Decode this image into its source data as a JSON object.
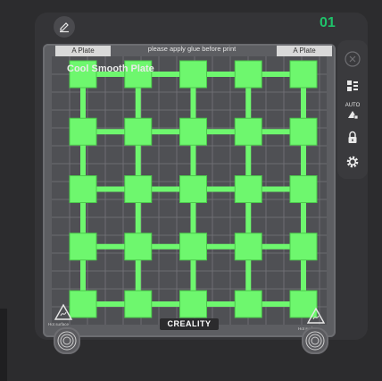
{
  "header": {
    "edit_icon": "pencil-icon",
    "plate_index": "01"
  },
  "toolbar": {
    "items": [
      {
        "name": "close-icon"
      },
      {
        "name": "arrange-icon"
      },
      {
        "name": "auto-orient-icon",
        "label": "AUTO"
      },
      {
        "name": "lock-icon"
      },
      {
        "name": "settings-icon"
      }
    ]
  },
  "plate": {
    "label_left": "A Plate",
    "label_right": "A Plate",
    "notice": "please apply glue before print",
    "name": "Cool Smooth Plate",
    "brand": "CREALITY",
    "warn_left": "Hot surface",
    "warn_right": "Hot surface"
  },
  "colors": {
    "object": "#6ef76e",
    "object_border": "#4cc84c",
    "plate_bg": "#4f5054",
    "accent": "#1fc26a"
  },
  "objects": {
    "rows": 5,
    "cols": 5,
    "count": 25
  }
}
